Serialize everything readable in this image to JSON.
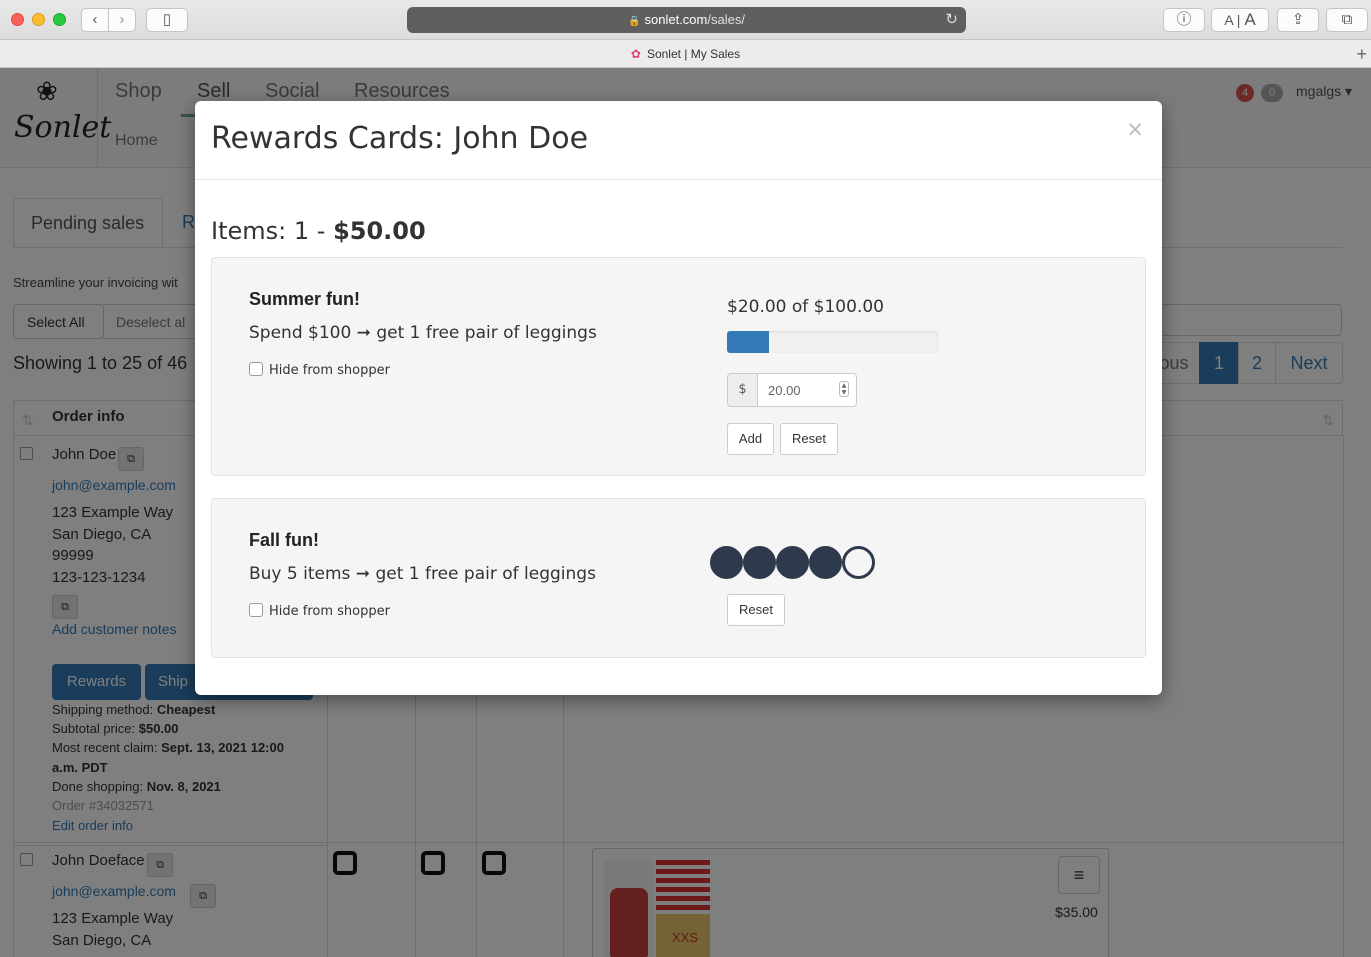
{
  "browser": {
    "url_host": "sonlet.com",
    "url_path": "/sales/",
    "tab_title": "Sonlet | My Sales",
    "text_size_small": "A",
    "text_size_large": "A"
  },
  "site": {
    "logo_text": "Sonlet",
    "nav": [
      "Shop",
      "Sell",
      "Social",
      "Resources"
    ],
    "subnav_home": "Home",
    "notifications": {
      "red": "4",
      "grey": "0"
    },
    "username": "mgalgs"
  },
  "page": {
    "tab_pending": "Pending sales",
    "tab_partial": "R",
    "streamline_text": "Streamline your invoicing wit",
    "select_all": "Select All",
    "deselect_all": "Deselect al",
    "showing": "Showing 1 to 25 of 46",
    "pagination": {
      "prev": "ous",
      "p1": "1",
      "p2": "2",
      "next": "Next"
    },
    "table_header": "Order info",
    "row1": {
      "name": "John Doe",
      "email": "john@example.com",
      "address1": "123 Example Way",
      "address2": "San Diego, CA",
      "zip": "99999",
      "phone": "123-123-1234",
      "add_notes": "Add customer notes",
      "rewards_btn": "Rewards",
      "shipping_btn": "Ship",
      "shipping_method_label": "Shipping method:",
      "shipping_method": "Cheapest",
      "subtotal_label": "Subtotal price:",
      "subtotal": "$50.00",
      "claim_label": "Most recent claim:",
      "claim": "Sept. 13, 2021 12:00",
      "claim2": "a.m. PDT",
      "done_label": "Done shopping:",
      "done": "Nov. 8, 2021",
      "order_no": "Order #34032571",
      "edit_order": "Edit order info"
    },
    "row2": {
      "name": "John Doeface",
      "email": "john@example.com",
      "address1": "123 Example Way",
      "address2": "San Diego, CA",
      "product_size": "XXS",
      "price": "$35.00"
    }
  },
  "modal": {
    "title": "Rewards Cards: John Doe",
    "close": "×",
    "items_prefix": "Items: 1 -",
    "items_total": "$50.00",
    "cards": [
      {
        "title": "Summer fun!",
        "description": "Spend $100 ➞ get 1 free pair of leggings",
        "hide_label": "Hide from shopper",
        "progress_label": "$20.00 of $100.00",
        "progress_fraction": 0.2,
        "currency_symbol": "$",
        "amount_value": "20.00",
        "add_label": "Add",
        "reset_label": "Reset"
      },
      {
        "title": "Fall fun!",
        "description": "Buy 5 items ➞ get 1 free pair of leggings",
        "hide_label": "Hide from shopper",
        "stamps_total": 5,
        "stamps_filled": 4,
        "reset_label": "Reset"
      }
    ]
  },
  "colors": {
    "primary": "#337ab7",
    "stamp": "#2e3a4b",
    "overlay": "rgba(0,0,0,0.5)"
  }
}
